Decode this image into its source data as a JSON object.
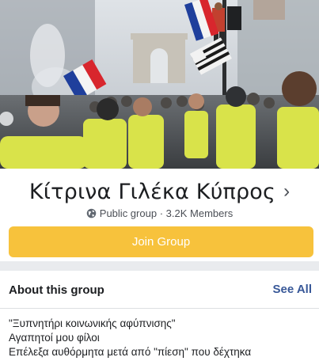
{
  "group": {
    "name": "Κίτρινα Γιλέκα Κύπρος",
    "privacy": "Public group",
    "separator": "·",
    "members": "3.2K Members"
  },
  "actions": {
    "join_label": "Join Group"
  },
  "about": {
    "title": "About this group",
    "see_all": "See All",
    "description_lines": [
      "\"Ξυπνητήρι  κοινωνικής αφύπνισης\"",
      "Αγαπητοί μου φίλοι",
      "Επέλεξα αυθόρμητα μετά από \"πίεση\" που δέχτηκα"
    ]
  },
  "colors": {
    "join_button": "#f7c23c",
    "link": "#385898",
    "divider": "#e9ebee"
  },
  "icons": {
    "chevron": "chevron-right-icon",
    "privacy": "globe-icon"
  }
}
